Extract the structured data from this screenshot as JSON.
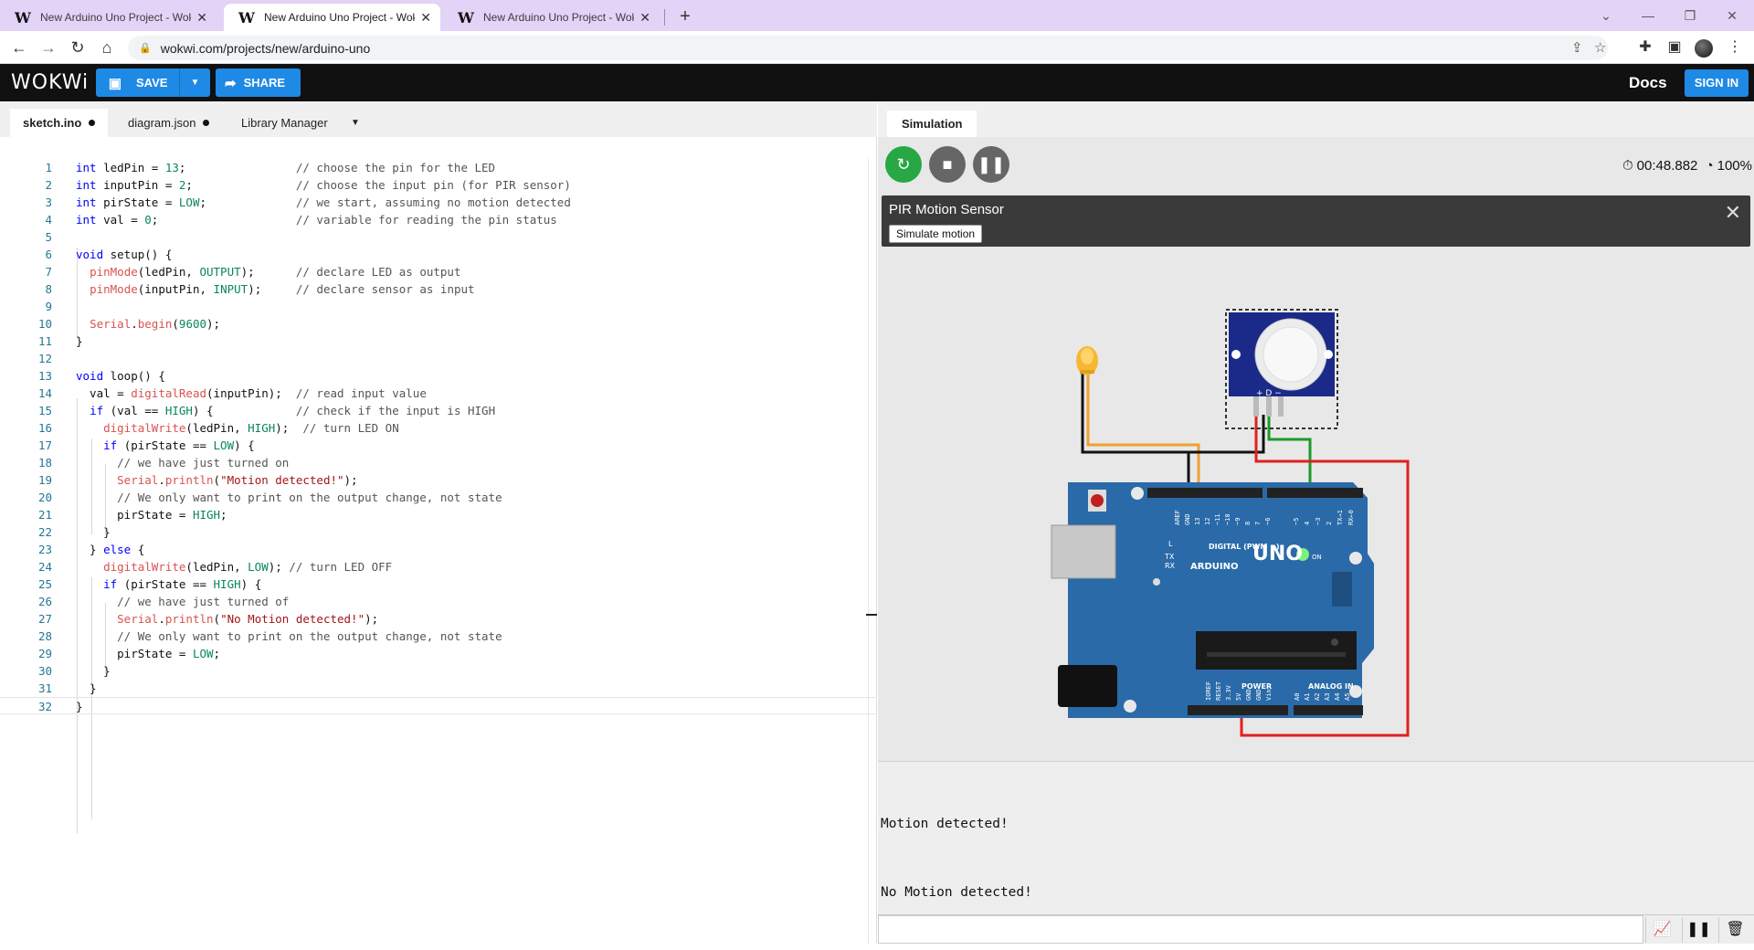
{
  "browser": {
    "tabs": [
      {
        "title": "New Arduino Uno Project - Wokwi",
        "active": false
      },
      {
        "title": "New Arduino Uno Project - Wokwi",
        "active": true
      },
      {
        "title": "New Arduino Uno Project - Wokwi",
        "active": false
      }
    ],
    "url": "wokwi.com/projects/new/arduino-uno"
  },
  "header": {
    "logo": "WOKWi",
    "save_label": "SAVE",
    "share_label": "SHARE",
    "docs_label": "Docs",
    "signin_label": "SIGN IN"
  },
  "editor": {
    "tabs": [
      {
        "label": "sketch.ino",
        "modified": true,
        "active": true
      },
      {
        "label": "diagram.json",
        "modified": true,
        "active": false
      },
      {
        "label": "Library Manager",
        "modified": false,
        "active": false
      }
    ],
    "lines": [
      "int ledPin = 13;                // choose the pin for the LED",
      "int inputPin = 2;               // choose the input pin (for PIR sensor)",
      "int pirState = LOW;             // we start, assuming no motion detected",
      "int val = 0;                    // variable for reading the pin status",
      "",
      "void setup() {",
      "  pinMode(ledPin, OUTPUT);      // declare LED as output",
      "  pinMode(inputPin, INPUT);     // declare sensor as input",
      "",
      "  Serial.begin(9600);",
      "}",
      "",
      "void loop() {",
      "  val = digitalRead(inputPin);  // read input value",
      "  if (val == HIGH) {            // check if the input is HIGH",
      "    digitalWrite(ledPin, HIGH);  // turn LED ON",
      "    if (pirState == LOW) {",
      "      // we have just turned on",
      "      Serial.println(\"Motion detected!\");",
      "      // We only want to print on the output change, not state",
      "      pirState = HIGH;",
      "    }",
      "  } else {",
      "    digitalWrite(ledPin, LOW); // turn LED OFF",
      "    if (pirState == HIGH) {",
      "      // we have just turned of",
      "      Serial.println(\"No Motion detected!\");",
      "      // We only want to print on the output change, not state",
      "      pirState = LOW;",
      "    }",
      "  }",
      "}"
    ]
  },
  "simulation": {
    "tab_label": "Simulation",
    "elapsed": "00:48.882",
    "speed": "100%",
    "part_panel": {
      "title": "PIR Motion Sensor",
      "action_label": "Simulate motion"
    },
    "board": {
      "model": "UNO",
      "brand": "ARDUINO",
      "digital_label": "DIGITAL (PWM ~)",
      "power_label": "POWER",
      "analog_label": "ANALOG IN",
      "on_label": "ON",
      "l_label": "L",
      "tx_label": "TX",
      "rx_label": "RX",
      "top_pin_labels": [
        "AREF",
        "GND",
        "13",
        "12",
        "~11",
        "~10",
        "~9",
        "8",
        "7",
        "~6",
        "~5",
        "4",
        "~3",
        "2",
        "TX→1",
        "RX←0"
      ],
      "bottom_pin_labels": [
        "IOREF",
        "RESET",
        "3.3V",
        "5V",
        "GND",
        "GND",
        "Vin",
        "A0",
        "A1",
        "A2",
        "A3",
        "A4",
        "A5"
      ]
    },
    "pir_pin_labels": "+ D −"
  },
  "serial": {
    "lines": [
      "Motion detected!",
      "No Motion detected!"
    ]
  },
  "colors": {
    "accent": "#1f8ae5",
    "tabbar": "#e2d3f7",
    "board": "#2a6aa8",
    "run_button": "#27a844",
    "wire_red": "#e02020",
    "wire_green": "#1a9a2a",
    "wire_orange": "#f0a030"
  }
}
